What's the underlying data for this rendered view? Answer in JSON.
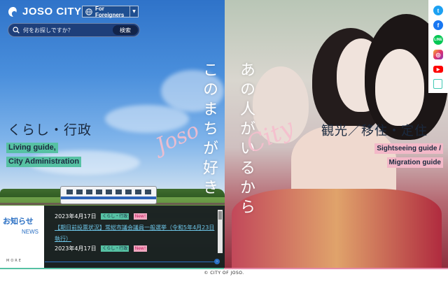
{
  "header": {
    "logo_text": "JOSO CITY",
    "lang_button": "For Foreigners",
    "search_placeholder": "何をお探しですか？",
    "search_button": "検索"
  },
  "left": {
    "title": "くらし・行政",
    "subtitle_line1": "Living guide,",
    "subtitle_line2": "City Administration",
    "vertical_text": "このまちが好き",
    "script_text": "Joso"
  },
  "right": {
    "title": "観光／移住・定住",
    "subtitle_line1": "Sightseeing guide /",
    "subtitle_line2": "Migration guide",
    "vertical_text": "あの人がいるから",
    "script_text": "City"
  },
  "news": {
    "label_jp": "お知らせ",
    "label_en": "NEWS",
    "more": "MORE",
    "items": [
      {
        "date": "2023年4月17日",
        "category": "くらし・行政",
        "badge": "New!",
        "title": "【期日前投票状況】常総市議会議員一般選挙（令和5年4月23日執行）"
      },
      {
        "date": "2023年4月17日",
        "category": "くらし・行政",
        "badge": "New!"
      }
    ]
  },
  "social": {
    "icons": [
      "twitter-icon",
      "facebook-icon",
      "line-icon",
      "instagram-icon",
      "youtube-icon",
      "note-icon"
    ],
    "colors": [
      "#1da1f2",
      "#1877f2",
      "#06c755",
      "#e1306c",
      "#ff0000",
      "#41c9b4"
    ]
  },
  "footer": {
    "copyright": "© CITY OF JOSO."
  }
}
